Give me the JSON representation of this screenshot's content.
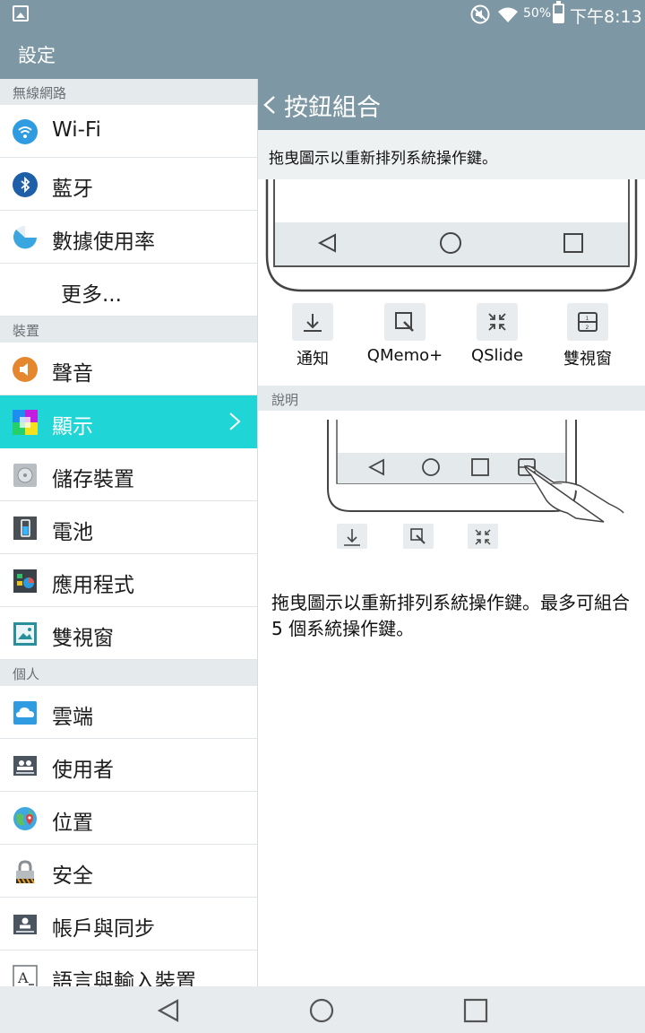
{
  "status_bar": {
    "battery_percent": "50%",
    "time": "下午8:13",
    "icons": [
      "gallery-icon",
      "mute-icon",
      "wifi-icon",
      "battery-icon"
    ]
  },
  "app": {
    "title": "設定"
  },
  "settings_list": {
    "sections": [
      {
        "title": "無線網路",
        "items": [
          {
            "label": "Wi-Fi",
            "icon": "wifi-icon"
          },
          {
            "label": "藍牙",
            "icon": "bluetooth-icon"
          },
          {
            "label": "數據使用率",
            "icon": "data-usage-icon"
          },
          {
            "label": "更多..."
          }
        ]
      },
      {
        "title": "裝置",
        "items": [
          {
            "label": "聲音",
            "icon": "sound-icon"
          },
          {
            "label": "顯示",
            "icon": "display-icon",
            "selected": true
          },
          {
            "label": "儲存裝置",
            "icon": "storage-icon"
          },
          {
            "label": "電池",
            "icon": "battery-icon"
          },
          {
            "label": "應用程式",
            "icon": "apps-icon"
          },
          {
            "label": "雙視窗",
            "icon": "dual-window-icon"
          }
        ]
      },
      {
        "title": "個人",
        "items": [
          {
            "label": "雲端",
            "icon": "cloud-icon"
          },
          {
            "label": "使用者",
            "icon": "users-icon"
          },
          {
            "label": "位置",
            "icon": "location-icon"
          },
          {
            "label": "安全",
            "icon": "lock-icon"
          },
          {
            "label": "帳戶與同步",
            "icon": "account-icon"
          },
          {
            "label": "語言與輸入裝置",
            "icon": "language-icon"
          }
        ]
      }
    ]
  },
  "detail": {
    "title": "按鈕組合",
    "instruction": "拖曳圖示以重新排列系統操作鍵。",
    "available_buttons": [
      {
        "label": "通知",
        "icon": "notification-icon"
      },
      {
        "label": "QMemo+",
        "icon": "qmemo-icon"
      },
      {
        "label": "QSlide",
        "icon": "qslide-icon"
      },
      {
        "label": "雙視窗",
        "icon": "dual-window-icon"
      }
    ],
    "help_section_title": "說明",
    "description": "拖曳圖示以重新排列系統操作鍵。最多可組合 5 個系統操作鍵。"
  },
  "nav_bar": {
    "buttons": [
      "back-icon",
      "home-icon",
      "recents-icon"
    ]
  },
  "colors": {
    "header": "#7d98a4",
    "accent_selected": "#1fd5d5",
    "section_bg": "#e5eaed",
    "nav_bar": "#e8ebed"
  }
}
